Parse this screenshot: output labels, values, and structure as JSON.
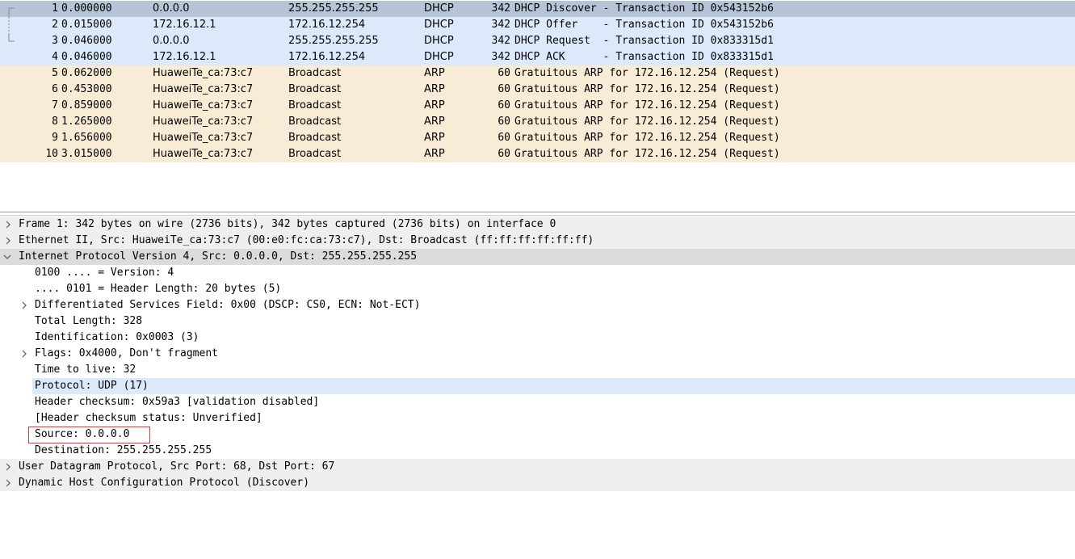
{
  "packet_list": {
    "rows": [
      {
        "no": "1",
        "time": "0.000000",
        "source": "0.0.0.0",
        "destination": "255.255.255.255",
        "protocol": "DHCP",
        "length": "342",
        "info": "DHCP Discover - Transaction ID 0x543152b6"
      },
      {
        "no": "2",
        "time": "0.015000",
        "source": "172.16.12.1",
        "destination": "172.16.12.254",
        "protocol": "DHCP",
        "length": "342",
        "info": "DHCP Offer    - Transaction ID 0x543152b6"
      },
      {
        "no": "3",
        "time": "0.046000",
        "source": "0.0.0.0",
        "destination": "255.255.255.255",
        "protocol": "DHCP",
        "length": "342",
        "info": "DHCP Request  - Transaction ID 0x833315d1"
      },
      {
        "no": "4",
        "time": "0.046000",
        "source": "172.16.12.1",
        "destination": "172.16.12.254",
        "protocol": "DHCP",
        "length": "342",
        "info": "DHCP ACK      - Transaction ID 0x833315d1"
      },
      {
        "no": "5",
        "time": "0.062000",
        "source": "HuaweiTe_ca:73:c7",
        "destination": "Broadcast",
        "protocol": "ARP",
        "length": "60",
        "info": "Gratuitous ARP for 172.16.12.254 (Request)"
      },
      {
        "no": "6",
        "time": "0.453000",
        "source": "HuaweiTe_ca:73:c7",
        "destination": "Broadcast",
        "protocol": "ARP",
        "length": "60",
        "info": "Gratuitous ARP for 172.16.12.254 (Request)"
      },
      {
        "no": "7",
        "time": "0.859000",
        "source": "HuaweiTe_ca:73:c7",
        "destination": "Broadcast",
        "protocol": "ARP",
        "length": "60",
        "info": "Gratuitous ARP for 172.16.12.254 (Request)"
      },
      {
        "no": "8",
        "time": "1.265000",
        "source": "HuaweiTe_ca:73:c7",
        "destination": "Broadcast",
        "protocol": "ARP",
        "length": "60",
        "info": "Gratuitous ARP for 172.16.12.254 (Request)"
      },
      {
        "no": "9",
        "time": "1.656000",
        "source": "HuaweiTe_ca:73:c7",
        "destination": "Broadcast",
        "protocol": "ARP",
        "length": "60",
        "info": "Gratuitous ARP for 172.16.12.254 (Request)"
      },
      {
        "no": "10",
        "time": "3.015000",
        "source": "HuaweiTe_ca:73:c7",
        "destination": "Broadcast",
        "protocol": "ARP",
        "length": "60",
        "info": "Gratuitous ARP for 172.16.12.254 (Request)"
      }
    ]
  },
  "details": {
    "frame": "Frame 1: 342 bytes on wire (2736 bits), 342 bytes captured (2736 bits) on interface 0",
    "ethernet": "Ethernet II, Src: HuaweiTe_ca:73:c7 (00:e0:fc:ca:73:c7), Dst: Broadcast (ff:ff:ff:ff:ff:ff)",
    "ipv4": "Internet Protocol Version 4, Src: 0.0.0.0, Dst: 255.255.255.255",
    "ipv4_fields": {
      "version": "0100 .... = Version: 4",
      "header_length": ".... 0101 = Header Length: 20 bytes (5)",
      "dsfield": "Differentiated Services Field: 0x00 (DSCP: CS0, ECN: Not-ECT)",
      "total_length": "Total Length: 328",
      "identification": "Identification: 0x0003 (3)",
      "flags": "Flags: 0x4000, Don't fragment",
      "ttl": "Time to live: 32",
      "protocol": "Protocol: UDP (17)",
      "checksum": "Header checksum: 0x59a3 [validation disabled]",
      "checksum_status": "[Header checksum status: Unverified]",
      "source": "Source: 0.0.0.0",
      "destination": "Destination: 255.255.255.255"
    },
    "udp": "User Datagram Protocol, Src Port: 68, Dst Port: 67",
    "dhcp": "Dynamic Host Configuration Protocol (Discover)"
  },
  "icons": {
    "collapsed": "chevron-right-icon",
    "expanded": "chevron-down-icon"
  },
  "colors": {
    "selected_row": "#b5c5d7",
    "dhcp_row": "#dbe9fb",
    "arp_row": "#f9ecd6",
    "highlight_box": "#d9393c"
  }
}
